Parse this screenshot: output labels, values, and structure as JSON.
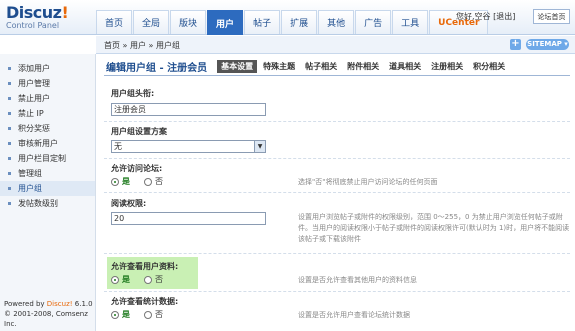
{
  "header": {
    "logo_brand": "Discuz",
    "logo_bang": "!",
    "logo_sub": "Control Panel",
    "nav": [
      {
        "label": "首页"
      },
      {
        "label": "全局"
      },
      {
        "label": "版块"
      },
      {
        "label": "用户"
      },
      {
        "label": "帖子"
      },
      {
        "label": "扩展"
      },
      {
        "label": "其他"
      },
      {
        "label": "广告"
      },
      {
        "label": "工具"
      },
      {
        "label": "UCenter"
      }
    ],
    "active_tab": "用户",
    "greeting": "您好,空谷",
    "logout": "[退出]",
    "home_button": "论坛首页"
  },
  "breadcrumb": "首页 » 用户 » 用户组",
  "breadcrumb_plus": "+",
  "sitemap": "SITEMAP ▾",
  "sidebar": {
    "items": [
      {
        "label": "添加用户"
      },
      {
        "label": "用户管理"
      },
      {
        "label": "禁止用户"
      },
      {
        "label": "禁止 IP"
      },
      {
        "label": "积分奖惩"
      },
      {
        "label": "审核新用户"
      },
      {
        "label": "用户栏目定制"
      },
      {
        "label": "管理组"
      },
      {
        "label": "用户组"
      },
      {
        "label": "发帖数级别"
      }
    ],
    "active_item": "用户组",
    "footer_powered": "Powered by ",
    "footer_product": "Discuz!",
    "footer_version": "6.1.0",
    "footer_copy": "© 2001-2008, Comsenz Inc."
  },
  "main": {
    "title": "编辑用户组 - 注册会员",
    "tabs": [
      {
        "label": "基本设置"
      },
      {
        "label": "特殊主题"
      },
      {
        "label": "帖子相关"
      },
      {
        "label": "附件相关"
      },
      {
        "label": "道具相关"
      },
      {
        "label": "注册相关"
      },
      {
        "label": "积分相关"
      }
    ],
    "active_tab": "基本设置",
    "fields": {
      "group_title": {
        "label": "用户组头衔:",
        "value": "注册会员"
      },
      "scheme": {
        "label": "用户组设置方案",
        "value": "无"
      },
      "allow_visit": {
        "label": "允许访问论坛:",
        "yes": "是",
        "no": "否",
        "help": "选择\"否\"将彻底禁止用户访问论坛的任何页面"
      },
      "read_access": {
        "label": "阅读权限:",
        "value": "20",
        "help": "设置用户浏览帖子或附件的权限级别，范围 0～255，0 为禁止用户浏览任何帖子或附件。当用户的阅读权限小于帖子或附件的阅读权限许可(默认时为 1)时，用户将不能阅读该帖子或下载该附件"
      },
      "view_profile": {
        "label": "允许查看用户资料:",
        "yes": "是",
        "no": "否",
        "help": "设置是否允许查看其他用户的资料信息"
      },
      "view_stats": {
        "label": "允许查看统计数据:",
        "yes": "是",
        "no": "否",
        "help": "设置是否允许用户查看论坛统计数据"
      }
    }
  }
}
